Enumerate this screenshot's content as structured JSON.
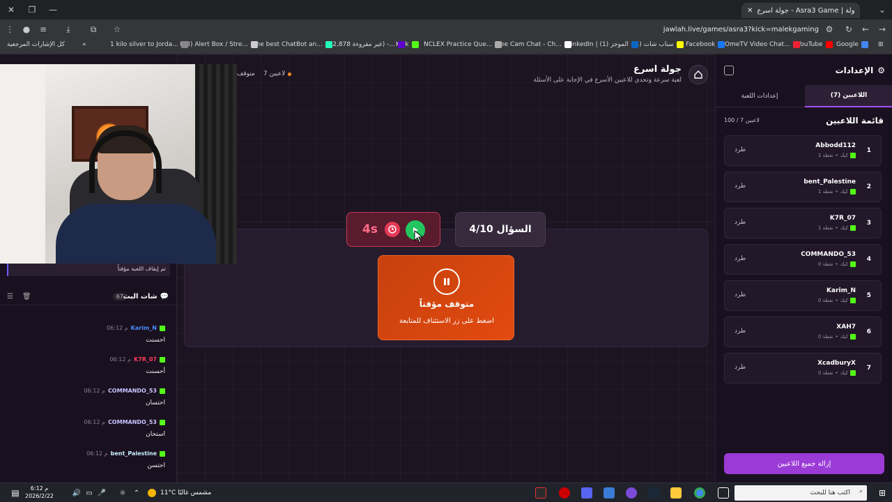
{
  "browser": {
    "tab_title": "جولة اسرع - Asra3 Game | جولة",
    "url": "jawlah.live/games/asra3?kick=malekgaming",
    "bookmarks": [
      {
        "label": "Google",
        "color": "#4285f4"
      },
      {
        "label": "YouTube",
        "color": "#ff0000"
      },
      {
        "label": "OmeTV Video Chat...",
        "color": "#e23"
      },
      {
        "label": "Facebook",
        "color": "#1877f2"
      },
      {
        "label": "(4) سناب شات",
        "color": "#fffc00"
      },
      {
        "label": "LinkedIn | الموجز (1)",
        "color": "#0a66c2"
      },
      {
        "label": "Free Cam Chat - Ch...",
        "color": "#fff"
      },
      {
        "label": "NCLEX Practice Que...",
        "color": "#aaa"
      },
      {
        "label": "Kick",
        "color": "#53fc18"
      },
      {
        "label": "(22,878 غير مقروءة) -...",
        "color": "#6001d2"
      },
      {
        "label": "The best ChatBot an...",
        "color": "#2fb"
      },
      {
        "label": "(33) Alert Box / Stre...",
        "color": "#ccc"
      },
      {
        "label": "1 kilo silver to Jorda...",
        "color": "#888"
      }
    ],
    "all_bookmarks": "كل الإشارات المرجعية"
  },
  "game": {
    "title": "جولة اسرع",
    "subtitle": "لعبة سرعة وتحدي للاعبين الأسرع في الإجابة على الأسئلة",
    "players_count": "7 لاعبين",
    "status": "متوقف",
    "timer": "4s",
    "question": "السؤال 4/10",
    "paused_title": "متوقف مؤقتاً",
    "paused_sub": "اضغط على زر الاستئناف للمتابعة"
  },
  "chat": {
    "notice": "تم إيقاف اللعبة مؤقتاً",
    "title": "شات البث",
    "count": "67",
    "messages": [
      {
        "time": "06:12 م",
        "user": "Karim_N",
        "color": "#4a8cff",
        "text": "احسنت"
      },
      {
        "time": "06:12 م",
        "user": "K7R_07",
        "color": "#ff3b5c",
        "text": "أحسنت"
      },
      {
        "time": "06:12 م",
        "user": "COMMANDO_53",
        "color": "#c9c2ff",
        "text": "احتسان"
      },
      {
        "time": "06:12 م",
        "user": "COMMANDO_53",
        "color": "#c9c2ff",
        "text": "استحان"
      },
      {
        "time": "06:12 م",
        "user": "bent_Palestine",
        "color": "#c9f0ff",
        "text": "احتسن"
      }
    ]
  },
  "settings": {
    "title": "الإعدادات",
    "tab_players": "اللاعبين (7)",
    "tab_game": "إعدادات اللعبة",
    "list_title": "قائمة اللاعبين",
    "list_count": "100 / 7 لاعبين",
    "kick_label": "طرد",
    "platform": "كيك",
    "players": [
      {
        "rank": "1",
        "name": "Abbodd112",
        "points": "1 نقطة"
      },
      {
        "rank": "2",
        "name": "bent_Palestine",
        "points": "1 نقطة"
      },
      {
        "rank": "3",
        "name": "K7R_07",
        "points": "1 نقطة"
      },
      {
        "rank": "4",
        "name": "COMMANDO_53",
        "points": "0 نقطة"
      },
      {
        "rank": "5",
        "name": "Karim_N",
        "points": "0 نقطة"
      },
      {
        "rank": "6",
        "name": "XAH7",
        "points": "0 نقطة"
      },
      {
        "rank": "7",
        "name": "XcadburyX",
        "points": "0 نقطة"
      }
    ],
    "remove_all": "إزالة جميع اللاعبين"
  },
  "taskbar": {
    "time": "6:12 م",
    "date": "2026/2/22",
    "weather": "11°C مشمس غالبًا",
    "search_placeholder": "اكتب هنا للبحث"
  }
}
